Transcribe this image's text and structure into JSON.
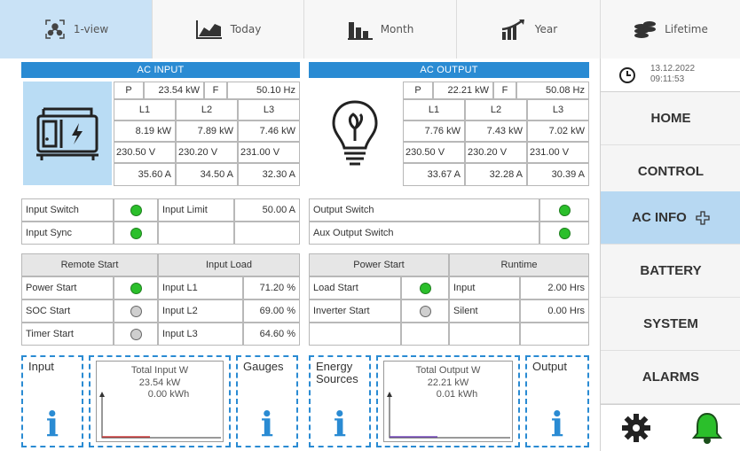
{
  "tabs": [
    {
      "label": "1-view",
      "icon": "network-icon",
      "active": true
    },
    {
      "label": "Today",
      "icon": "area-chart-icon",
      "active": false
    },
    {
      "label": "Month",
      "icon": "bar-chart-icon",
      "active": false
    },
    {
      "label": "Year",
      "icon": "growth-chart-icon",
      "active": false
    },
    {
      "label": "Lifetime",
      "icon": "coin-stack-icon",
      "active": false
    }
  ],
  "ac_input": {
    "title": "AC INPUT",
    "p_label": "P",
    "p_value": "23.54 kW",
    "f_label": "F",
    "f_value": "50.10 Hz",
    "phases": [
      "L1",
      "L2",
      "L3"
    ],
    "power": [
      "8.19 kW",
      "7.89 kW",
      "7.46 kW"
    ],
    "voltage": [
      "230.50 V",
      "230.20 V",
      "231.00 V"
    ],
    "current": [
      "35.60 A",
      "34.50 A",
      "32.30 A"
    ]
  },
  "ac_output": {
    "title": "AC OUTPUT",
    "p_label": "P",
    "p_value": "22.21 kW",
    "f_label": "F",
    "f_value": "50.08 Hz",
    "phases": [
      "L1",
      "L2",
      "L3"
    ],
    "power": [
      "7.76 kW",
      "7.43 kW",
      "7.02 kW"
    ],
    "voltage": [
      "230.50 V",
      "230.20 V",
      "231.00 V"
    ],
    "current": [
      "33.67 A",
      "32.28 A",
      "30.39 A"
    ]
  },
  "input_status": {
    "switch_label": "Input Switch",
    "switch_state": "on",
    "limit_label": "Input Limit",
    "limit_value": "50.00 A",
    "sync_label": "Input Sync",
    "sync_state": "on"
  },
  "output_status": {
    "switch_label": "Output Switch",
    "switch_state": "on",
    "aux_label": "Aux Output Switch",
    "aux_state": "on"
  },
  "remote_start": {
    "header": "Remote Start",
    "rows": [
      {
        "label": "Power Start",
        "state": "on"
      },
      {
        "label": "SOC Start",
        "state": "off"
      },
      {
        "label": "Timer Start",
        "state": "off"
      }
    ]
  },
  "input_load": {
    "header": "Input Load",
    "rows": [
      {
        "label": "Input L1",
        "value": "71.20 %"
      },
      {
        "label": "Input L2",
        "value": "69.00 %"
      },
      {
        "label": "Input L3",
        "value": "64.60 %"
      }
    ]
  },
  "power_start": {
    "header": "Power Start",
    "rows": [
      {
        "label": "Load Start",
        "state": "on"
      },
      {
        "label": "Inverter Start",
        "state": "off"
      }
    ]
  },
  "runtime": {
    "header": "Runtime",
    "rows": [
      {
        "label": "Input",
        "value": "2.00 Hrs"
      },
      {
        "label": "Silent",
        "value": "0.00 Hrs"
      }
    ]
  },
  "tiles": {
    "input": "Input",
    "gauges": "Gauges",
    "energy_sources_1": "Energy",
    "energy_sources_2": "Sources",
    "output": "Output",
    "info_glyph": "i"
  },
  "graph_input": {
    "title": "Total Input W",
    "power": "23.54 kW",
    "energy": "0.00 kWh"
  },
  "graph_output": {
    "title": "Total Output W",
    "power": "22.21 kW",
    "energy": "0.01 kWh"
  },
  "datetime": {
    "date": "13.12.2022",
    "time": "09:11:53"
  },
  "nav": [
    {
      "label": "HOME",
      "active": false
    },
    {
      "label": "CONTROL",
      "active": false
    },
    {
      "label": "AC INFO",
      "active": true
    },
    {
      "label": "BATTERY",
      "active": false
    },
    {
      "label": "SYSTEM",
      "active": false
    },
    {
      "label": "ALARMS",
      "active": false
    }
  ],
  "colors": {
    "accent": "#2a8bd3",
    "active_tab": "#c9e2f6",
    "active_nav": "#b7d8f2",
    "led_on": "#2bbf2b",
    "led_off": "#cfcfcf"
  }
}
